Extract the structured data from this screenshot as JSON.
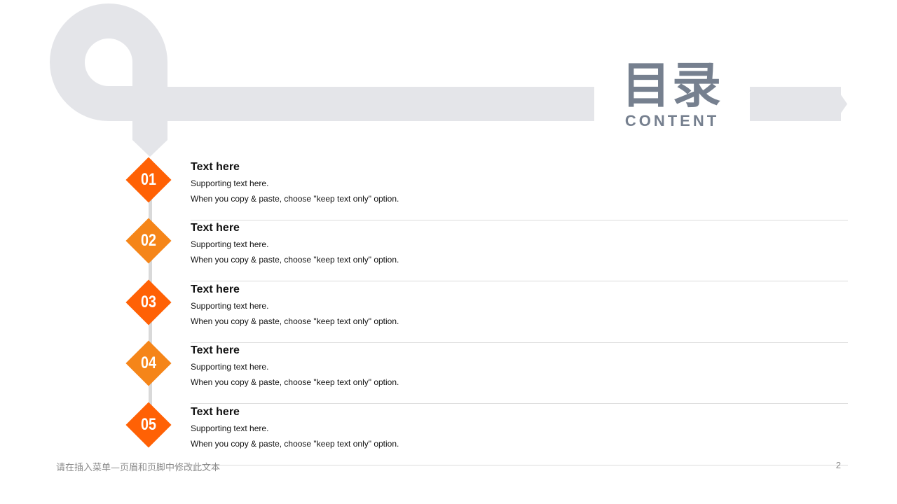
{
  "title": {
    "cn": "目录",
    "en": "CONTENT"
  },
  "colors": {
    "deco": "#e4e5e9",
    "title": "#76808f",
    "connector": "#d9d9d9",
    "item_odd": "#ff6105",
    "item_even": "#f58519"
  },
  "items": [
    {
      "num": "01",
      "title": "Text here",
      "subtitle": "Supporting text here.",
      "desc": "When you copy & paste, choose \"keep text only\" option."
    },
    {
      "num": "02",
      "title": "Text here",
      "subtitle": "Supporting text here.",
      "desc": "When you copy & paste, choose \"keep text only\" option."
    },
    {
      "num": "03",
      "title": "Text here",
      "subtitle": "Supporting text here.",
      "desc": "When you copy & paste, choose \"keep text only\" option."
    },
    {
      "num": "04",
      "title": "Text here",
      "subtitle": "Supporting text here.",
      "desc": "When you copy & paste, choose \"keep text only\" option."
    },
    {
      "num": "05",
      "title": "Text here",
      "subtitle": "Supporting text here.",
      "desc": "When you copy & paste, choose \"keep text only\" option."
    }
  ],
  "footer": {
    "text": "请在插入菜单—页眉和页脚中修改此文本",
    "page": "2"
  }
}
